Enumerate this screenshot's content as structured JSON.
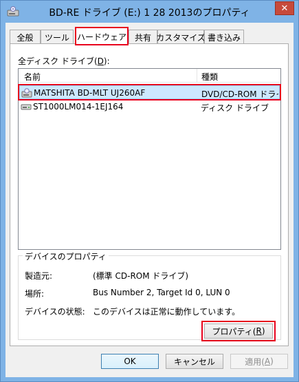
{
  "window": {
    "title": "BD-RE ドライブ (E:) 1 28 2013のプロパティ",
    "close_label": "✕"
  },
  "tabs": [
    {
      "label": "全般"
    },
    {
      "label": "ツール"
    },
    {
      "label": "ハードウェア"
    },
    {
      "label": "共有"
    },
    {
      "label": "カスタマイズ"
    },
    {
      "label": "書き込み"
    }
  ],
  "drives": {
    "label_prefix": "全ディスク ドライブ(",
    "label_key": "D",
    "label_suffix": "):",
    "columns": {
      "name": "名前",
      "type": "種類"
    },
    "rows": [
      {
        "name": "MATSHITA BD-MLT UJ260AF",
        "type": "DVD/CD-ROM ドライブ",
        "icon": "optical-drive-icon"
      },
      {
        "name": "ST1000LM014-1EJ164",
        "type": "ディスク ドライブ",
        "icon": "hard-disk-icon"
      }
    ]
  },
  "device_properties": {
    "title": "デバイスのプロパティ",
    "manufacturer_label": "製造元:",
    "manufacturer_value": "(標準 CD-ROM ドライブ)",
    "location_label": "場所:",
    "location_value": "Bus Number 2, Target Id 0, LUN 0",
    "status_label": "デバイスの状態:",
    "status_value": "このデバイスは正常に動作しています。",
    "properties_button_prefix": "プロパティ(",
    "properties_button_key": "R",
    "properties_button_suffix": ")"
  },
  "footer": {
    "ok_label": "OK",
    "cancel_label": "キャンセル",
    "apply_prefix": "適用(",
    "apply_key": "A",
    "apply_suffix": ")"
  },
  "colors": {
    "highlight": "#e8001c",
    "selection": "#cde8ff",
    "frame": "#7fb3e6"
  }
}
